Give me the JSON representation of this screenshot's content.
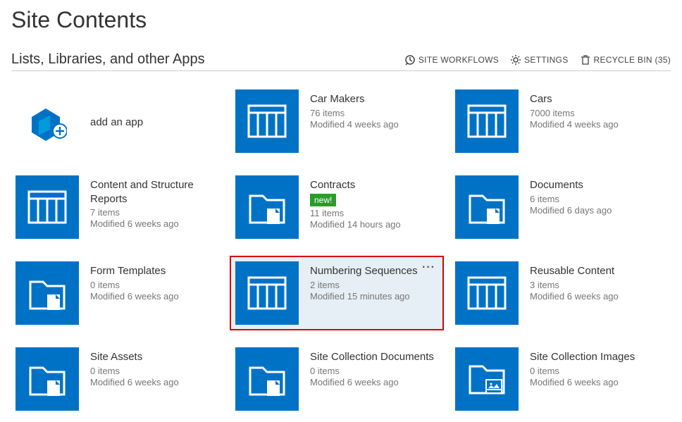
{
  "header": {
    "title": "Site Contents",
    "subtitle": "Lists, Libraries, and other Apps",
    "actions": {
      "workflows": "SITE WORKFLOWS",
      "settings": "SETTINGS",
      "recyclebin": "RECYCLE BIN (35)"
    }
  },
  "addapp": {
    "label": "add an app"
  },
  "items": [
    {
      "title": "Car Makers",
      "items_text": "76 items",
      "modified_text": "Modified 4 weeks ago",
      "icon": "list",
      "new_badge": false,
      "highlighted": false
    },
    {
      "title": "Cars",
      "items_text": "7000 items",
      "modified_text": "Modified 4 weeks ago",
      "icon": "list",
      "new_badge": false,
      "highlighted": false
    },
    {
      "title": "Content and Structure Reports",
      "items_text": "7 items",
      "modified_text": "Modified 6 weeks ago",
      "icon": "list",
      "new_badge": false,
      "highlighted": false
    },
    {
      "title": "Contracts",
      "items_text": "11 items",
      "modified_text": "Modified 14 hours ago",
      "icon": "library",
      "new_badge": true,
      "highlighted": false
    },
    {
      "title": "Documents",
      "items_text": "6 items",
      "modified_text": "Modified 6 days ago",
      "icon": "library",
      "new_badge": false,
      "highlighted": false
    },
    {
      "title": "Form Templates",
      "items_text": "0 items",
      "modified_text": "Modified 6 weeks ago",
      "icon": "library",
      "new_badge": false,
      "highlighted": false
    },
    {
      "title": "Numbering Sequences",
      "items_text": "2 items",
      "modified_text": "Modified 15 minutes ago",
      "icon": "list",
      "new_badge": false,
      "highlighted": true
    },
    {
      "title": "Reusable Content",
      "items_text": "3 items",
      "modified_text": "Modified 6 weeks ago",
      "icon": "list",
      "new_badge": false,
      "highlighted": false
    },
    {
      "title": "Site Assets",
      "items_text": "0 items",
      "modified_text": "Modified 6 weeks ago",
      "icon": "library",
      "new_badge": false,
      "highlighted": false
    },
    {
      "title": "Site Collection Documents",
      "items_text": "0 items",
      "modified_text": "Modified 6 weeks ago",
      "icon": "library",
      "new_badge": false,
      "highlighted": false
    },
    {
      "title": "Site Collection Images",
      "items_text": "0 items",
      "modified_text": "Modified 6 weeks ago",
      "icon": "image-library",
      "new_badge": false,
      "highlighted": false
    }
  ]
}
